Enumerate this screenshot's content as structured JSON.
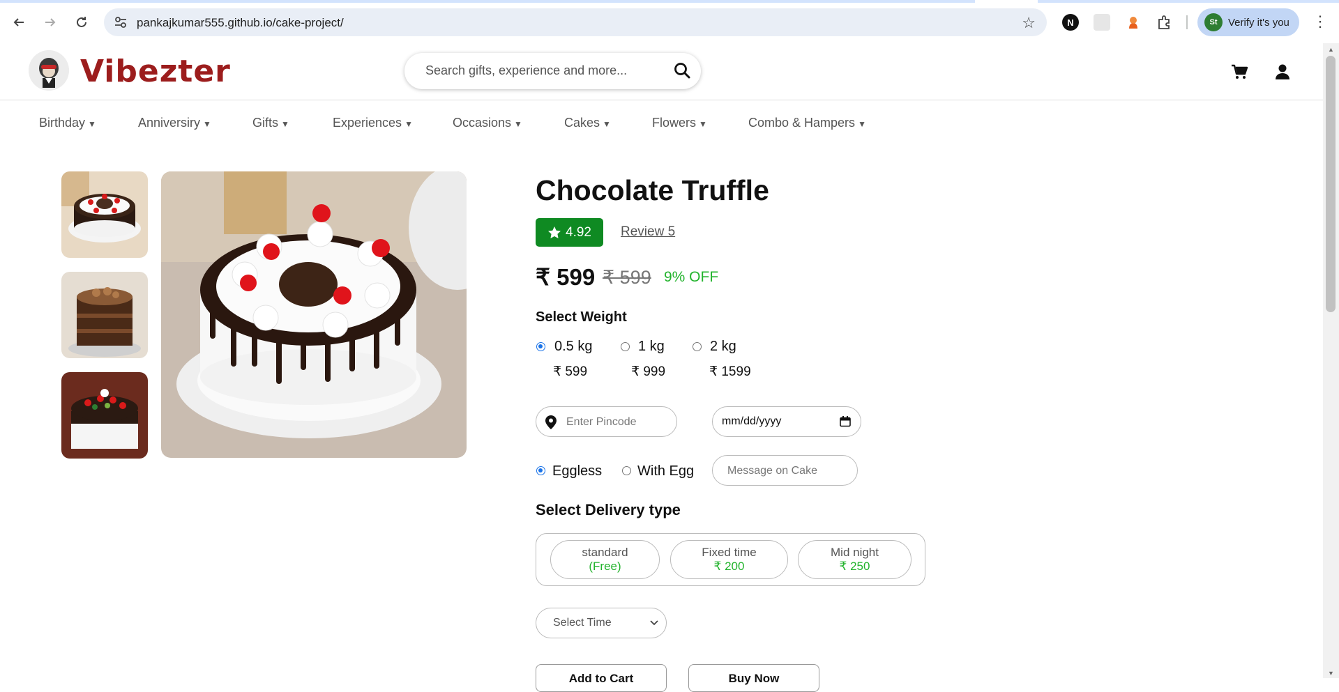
{
  "browser": {
    "url": "pankajkumar555.github.io/cake-project/",
    "verify_label": "Verify it's you",
    "ext_n_label": "N",
    "badge_initials": "St"
  },
  "header": {
    "brand": "Vibezter",
    "search_placeholder": "Search gifts, experience and more..."
  },
  "nav": {
    "categories": [
      "Birthday",
      "Anniversiry",
      "Gifts",
      "Experiences",
      "Occasions",
      "Cakes",
      "Flowers",
      "Combo & Hampers"
    ]
  },
  "product": {
    "title": "Chocolate Truffle",
    "rating": "4.92",
    "review_link": "Review 5",
    "price": "₹ 599",
    "old_price": "₹ 599",
    "discount": "9% OFF"
  },
  "weight": {
    "heading": "Select Weight",
    "options": [
      {
        "label": "0.5 kg",
        "price": "₹ 599",
        "selected": true
      },
      {
        "label": "1 kg",
        "price": "₹ 999",
        "selected": false
      },
      {
        "label": "2 kg",
        "price": "₹ 1599",
        "selected": false
      }
    ]
  },
  "form": {
    "pincode_placeholder": "Enter Pincode",
    "date_value": "mm/dd/yyyy",
    "egg_options": [
      {
        "label": "Eggless",
        "selected": true
      },
      {
        "label": "With Egg",
        "selected": false
      }
    ],
    "message_placeholder": "Message on Cake"
  },
  "delivery": {
    "heading": "Select Delivery type",
    "options": [
      {
        "name": "standard",
        "fee": "(Free)"
      },
      {
        "name": "Fixed time",
        "fee": "₹ 200"
      },
      {
        "name": "Mid night",
        "fee": "₹ 250"
      }
    ],
    "time_select": "Select Time"
  },
  "actions": {
    "add_to_cart": "Add to Cart",
    "buy_now": "Buy Now"
  },
  "colors": {
    "brand": "#9c1d1d",
    "rating_bg": "#0f8a22",
    "discount": "#22b32c",
    "radio_accent": "#1a73e8"
  }
}
